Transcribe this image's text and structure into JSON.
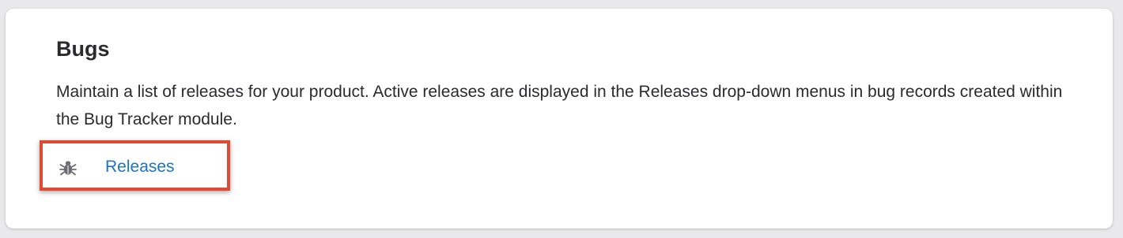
{
  "section": {
    "title": "Bugs",
    "description": "Maintain a list of releases for your product. Active releases are displayed in the Releases drop-down menus in bug records created within the Bug Tracker module.",
    "links": [
      {
        "label": "Releases",
        "icon": "bug-icon"
      }
    ]
  },
  "colors": {
    "page_background": "#e9e9eb",
    "card_background": "#ffffff",
    "text": "#2b2b2e",
    "link": "#1a73c4",
    "highlight_border": "#e04a33",
    "icon": "#6c6c72"
  }
}
